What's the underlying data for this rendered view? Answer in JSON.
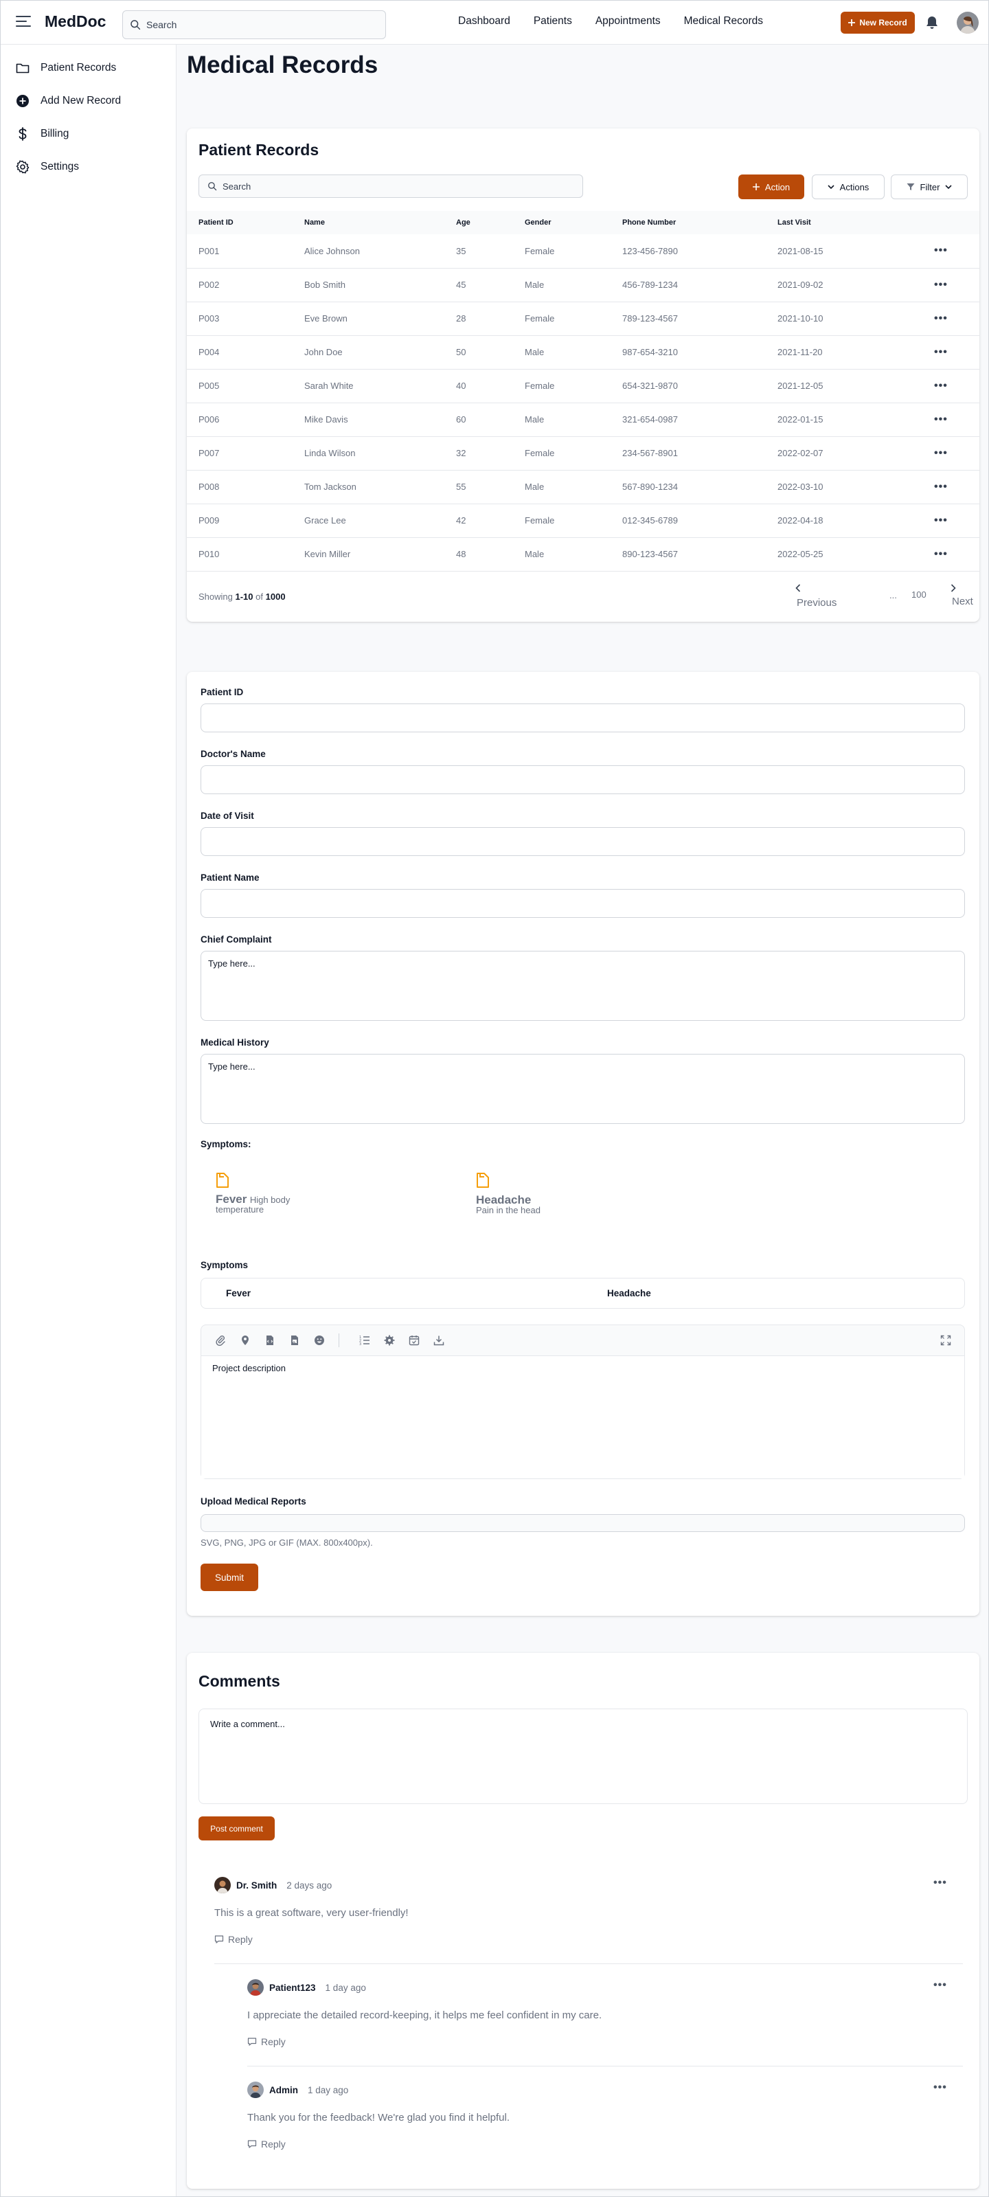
{
  "app": {
    "brand": "MedDoc"
  },
  "topnav": {
    "search_placeholder": "Search",
    "links": [
      "Dashboard",
      "Patients",
      "Appointments",
      "Medical Records"
    ],
    "new_record_label": "New Record"
  },
  "sidebar": {
    "items": [
      {
        "label": "Patient Records",
        "icon": "folder-icon"
      },
      {
        "label": "Add New Record",
        "icon": "plus-circle-icon"
      },
      {
        "label": "Billing",
        "icon": "dollar-icon"
      },
      {
        "label": "Settings",
        "icon": "gear-icon"
      }
    ]
  },
  "page": {
    "title": "Medical Records"
  },
  "records": {
    "title": "Patient Records",
    "search_placeholder": "Search",
    "action_label": "Action",
    "actions_label": "Actions",
    "filter_label": "Filter",
    "columns": [
      "Patient ID",
      "Name",
      "Age",
      "Gender",
      "Phone Number",
      "Last Visit"
    ],
    "rows": [
      [
        "P001",
        "Alice Johnson",
        "35",
        "Female",
        "123-456-7890",
        "2021-08-15"
      ],
      [
        "P002",
        "Bob Smith",
        "45",
        "Male",
        "456-789-1234",
        "2021-09-02"
      ],
      [
        "P003",
        "Eve Brown",
        "28",
        "Female",
        "789-123-4567",
        "2021-10-10"
      ],
      [
        "P004",
        "John Doe",
        "50",
        "Male",
        "987-654-3210",
        "2021-11-20"
      ],
      [
        "P005",
        "Sarah White",
        "40",
        "Female",
        "654-321-9870",
        "2021-12-05"
      ],
      [
        "P006",
        "Mike Davis",
        "60",
        "Male",
        "321-654-0987",
        "2022-01-15"
      ],
      [
        "P007",
        "Linda Wilson",
        "32",
        "Female",
        "234-567-8901",
        "2022-02-07"
      ],
      [
        "P008",
        "Tom Jackson",
        "55",
        "Male",
        "567-890-1234",
        "2022-03-10"
      ],
      [
        "P009",
        "Grace Lee",
        "42",
        "Female",
        "012-345-6789",
        "2022-04-18"
      ],
      [
        "P010",
        "Kevin Miller",
        "48",
        "Male",
        "890-123-4567",
        "2022-05-25"
      ]
    ],
    "showing_prefix": "Showing",
    "showing_range": "1-10",
    "showing_of": "of",
    "showing_total": "1000",
    "pager": {
      "previous": "Previous",
      "ellipsis": "...",
      "last_page": "100",
      "next": "Next"
    }
  },
  "form": {
    "patient_id_label": "Patient ID",
    "doctor_name_label": "Doctor's Name",
    "date_of_visit_label": "Date of Visit",
    "patient_name_label": "Patient Name",
    "chief_complaint_label": "Chief Complaint",
    "chief_complaint_placeholder": "Type here...",
    "medical_history_label": "Medical History",
    "medical_history_placeholder": "Type here...",
    "symptoms_heading": "Symptoms:",
    "symptom_cards": [
      {
        "title": "Fever",
        "desc": "High body temperature"
      },
      {
        "title": "Headache",
        "desc": "Pain in the head"
      }
    ],
    "symptoms_label": "Symptoms",
    "symptoms_selected": [
      "Fever",
      "Headache"
    ],
    "editor_placeholder": "Project description",
    "upload_label": "Upload Medical Reports",
    "upload_hint": "SVG, PNG, JPG or GIF (MAX. 800x400px).",
    "submit_label": "Submit"
  },
  "comments": {
    "title": "Comments",
    "input_placeholder": "Write a comment...",
    "post_label": "Post comment",
    "reply_label": "Reply",
    "items": [
      {
        "author": "Dr. Smith",
        "date": "2 days ago",
        "text": "This is a great software, very user-friendly!"
      },
      {
        "author": "Patient123",
        "date": "1 day ago",
        "text": "I appreciate the detailed record-keeping, it helps me feel confident in my care."
      },
      {
        "author": "Admin",
        "date": "1 day ago",
        "text": "Thank you for the feedback! We're glad you find it helpful."
      }
    ]
  },
  "colors": {
    "accent": "#b94a09",
    "symptom_icon": "#f59e0b"
  }
}
